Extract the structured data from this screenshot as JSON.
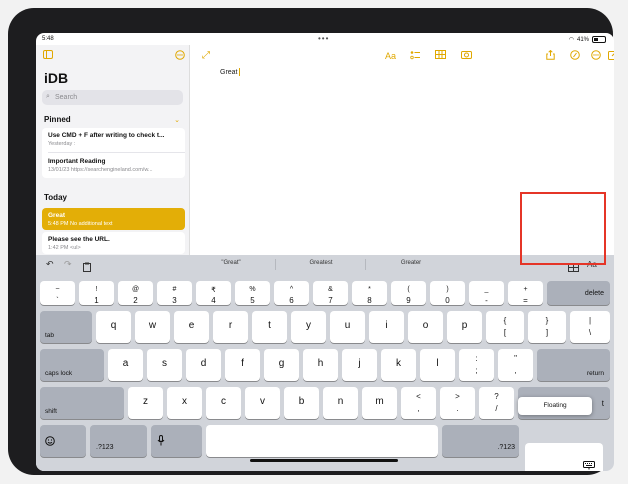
{
  "status_bar": {
    "time": "5:48",
    "dots": "•••",
    "battery": "41%"
  },
  "sidebar": {
    "title": "iDB",
    "search_placeholder": "Search",
    "pinned_label": "Pinned",
    "pinned_notes": [
      {
        "title": "Use CMD + F after writing to check t...",
        "sub": "Yesterday  :"
      },
      {
        "title": "Important Reading",
        "sub": "13/01/23  https://searchengineland.com/w..."
      }
    ],
    "today_label": "Today",
    "today_notes": [
      {
        "title": "Great",
        "sub": "5:48 PM  No additional text"
      },
      {
        "title": "Please see the URL.",
        "sub": "1:42 PM  <ul>"
      }
    ]
  },
  "editor": {
    "text": "Great",
    "toolbar": {
      "format_label": "Aa"
    }
  },
  "keyboard": {
    "suggestions": [
      "\"Great\"",
      "Greatest",
      "Greater"
    ],
    "format_label": "Aa",
    "number_row": [
      {
        "top": "~",
        "bot": "`"
      },
      {
        "top": "!",
        "bot": "1"
      },
      {
        "top": "@",
        "bot": "2"
      },
      {
        "top": "#",
        "bot": "3"
      },
      {
        "top": "₹",
        "bot": "4"
      },
      {
        "top": "%",
        "bot": "5"
      },
      {
        "top": "^",
        "bot": "6"
      },
      {
        "top": "&",
        "bot": "7"
      },
      {
        "top": "*",
        "bot": "8"
      },
      {
        "top": "(",
        "bot": "9"
      },
      {
        "top": ")",
        "bot": "0"
      },
      {
        "top": "_",
        "bot": "-"
      },
      {
        "top": "+",
        "bot": "="
      }
    ],
    "delete_label": "delete",
    "tab_label": "tab",
    "row_q": [
      "q",
      "w",
      "e",
      "r",
      "t",
      "y",
      "u",
      "i",
      "o",
      "p"
    ],
    "row_q_syms": [
      {
        "top": "{",
        "bot": "["
      },
      {
        "top": "}",
        "bot": "]"
      },
      {
        "top": "|",
        "bot": "\\"
      }
    ],
    "caps_label": "caps lock",
    "row_a": [
      "a",
      "s",
      "d",
      "f",
      "g",
      "h",
      "j",
      "k",
      "l"
    ],
    "row_a_syms": [
      {
        "top": ":",
        "bot": ";"
      },
      {
        "top": "\"",
        "bot": ","
      }
    ],
    "return_label": "return",
    "shift_label": "shift",
    "row_z": [
      "z",
      "x",
      "c",
      "v",
      "b",
      "n",
      "m"
    ],
    "row_z_syms": [
      {
        "top": "<",
        "bot": ","
      },
      {
        "top": ">",
        "bot": "."
      },
      {
        "top": "?",
        "bot": "/"
      }
    ],
    "shift_right_fragment": "t",
    "numbers_label": ".?123",
    "floating_label": "Floating"
  },
  "colors": {
    "accent": "#e3ae07",
    "highlight": "#e53527"
  }
}
